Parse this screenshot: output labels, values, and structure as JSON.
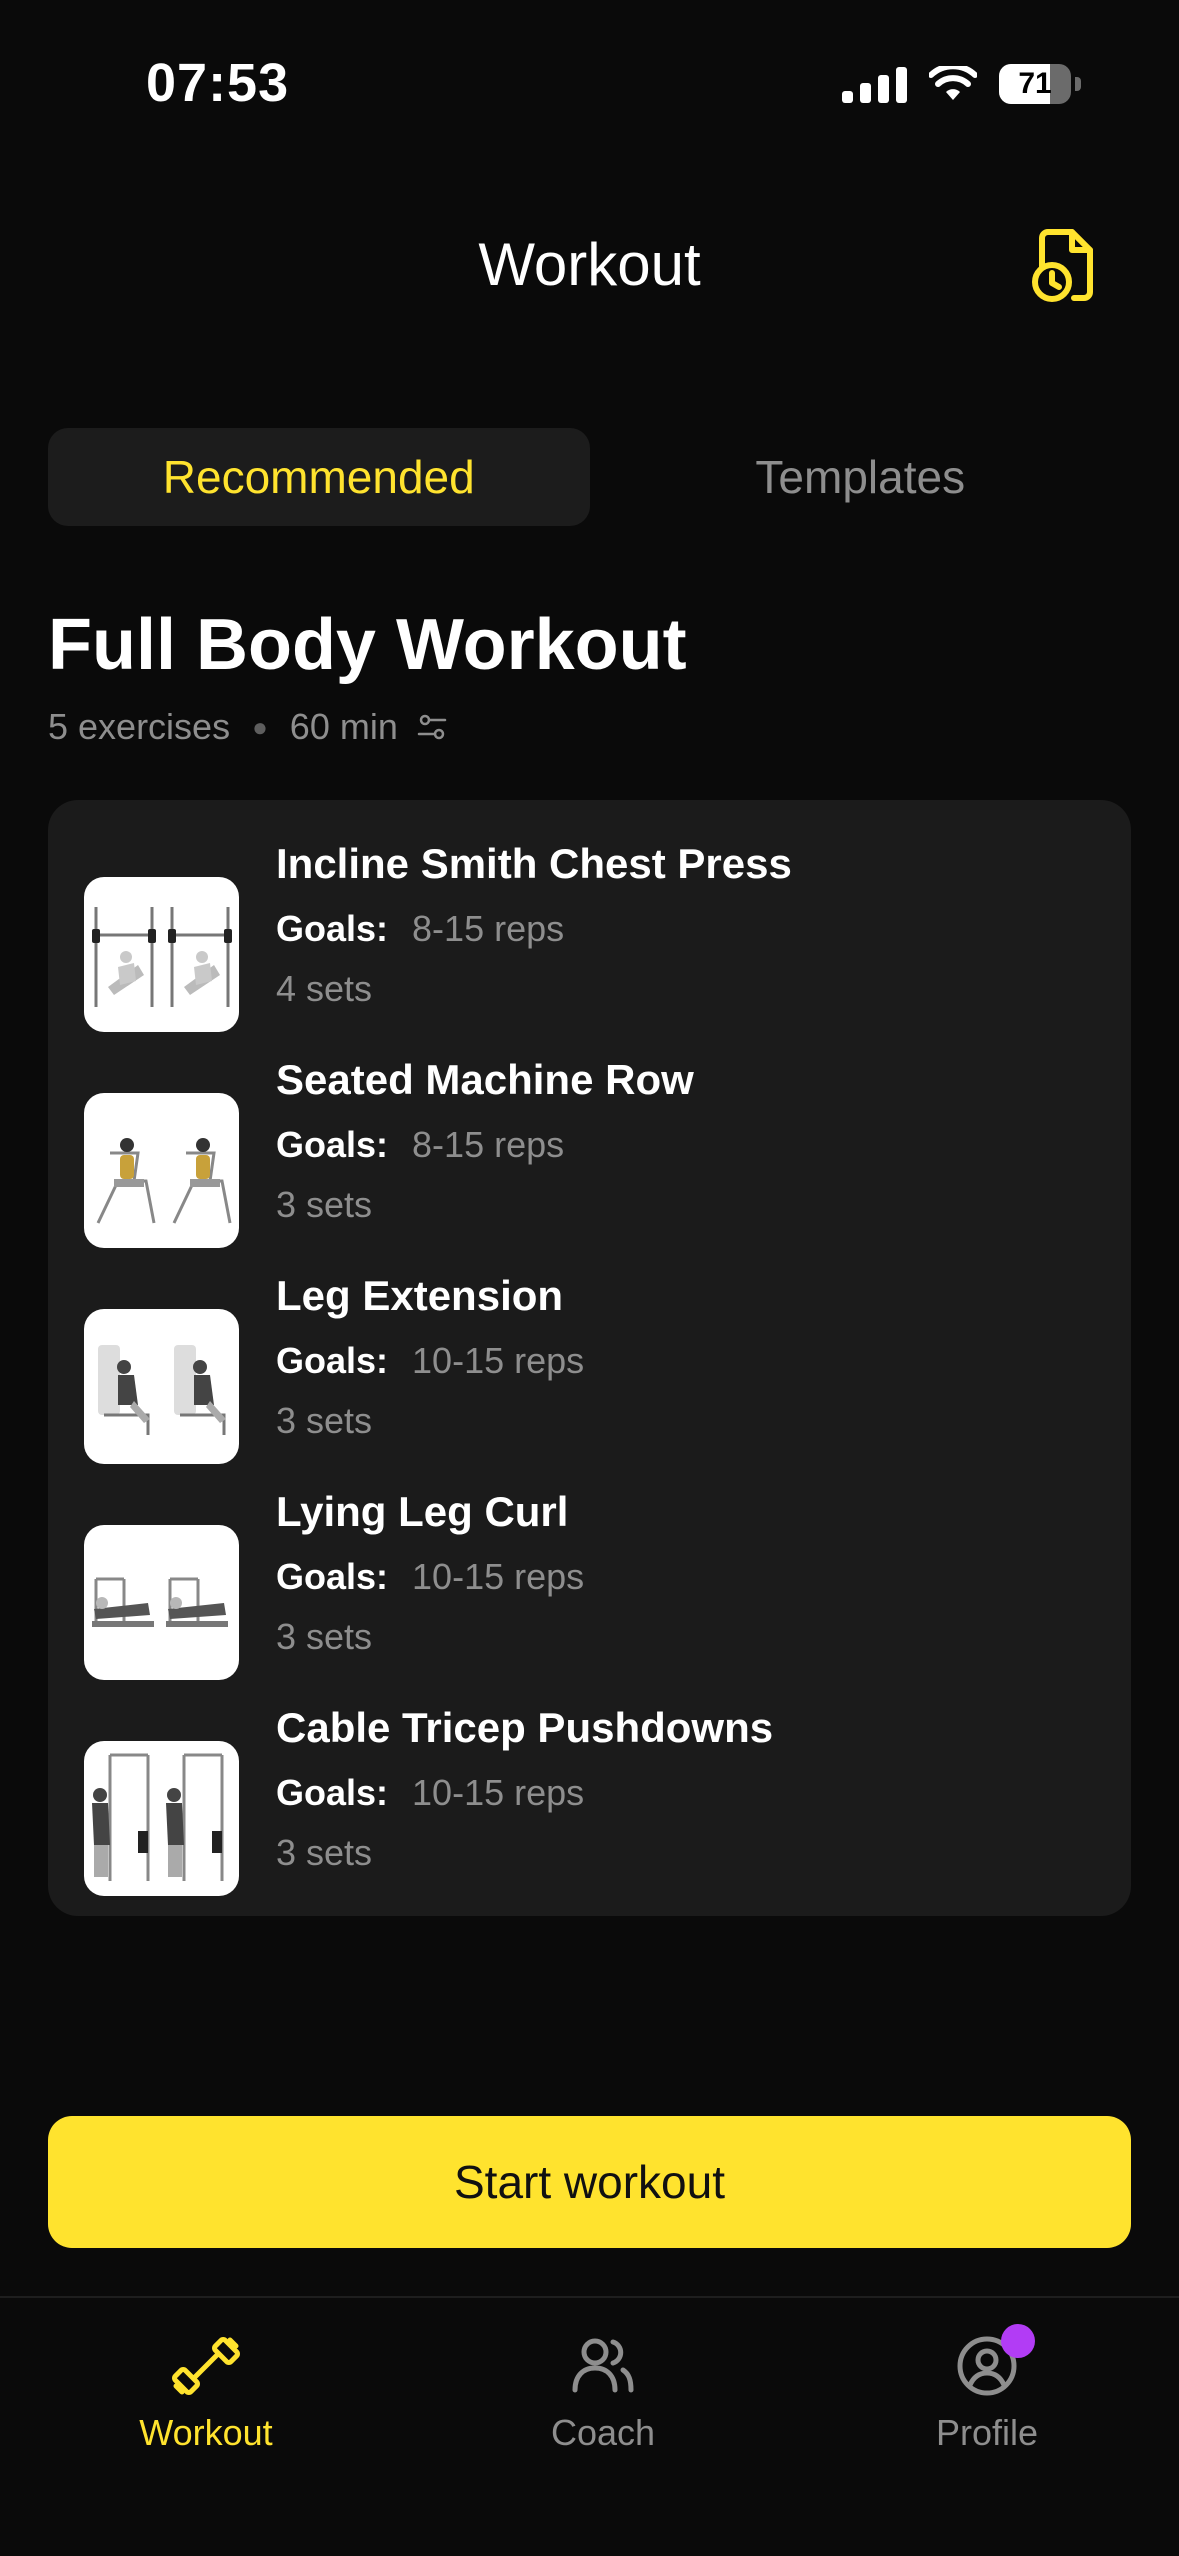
{
  "status_bar": {
    "time": "07:53",
    "battery": "71",
    "battery_level": 0.71
  },
  "header": {
    "title": "Workout",
    "history_icon": "history-icon"
  },
  "tabs": [
    {
      "label": "Recommended",
      "active": true
    },
    {
      "label": "Templates",
      "active": false
    }
  ],
  "workout": {
    "title": "Full Body Workout",
    "exercise_count": "5 exercises",
    "duration": "60 min"
  },
  "exercises": [
    {
      "name": "Incline Smith Chest Press",
      "goals_label": "Goals:",
      "reps": "8-15 reps",
      "sets": "4 sets"
    },
    {
      "name": "Seated Machine Row",
      "goals_label": "Goals:",
      "reps": "8-15 reps",
      "sets": "3 sets"
    },
    {
      "name": "Leg Extension",
      "goals_label": "Goals:",
      "reps": "10-15 reps",
      "sets": "3 sets"
    },
    {
      "name": "Lying Leg Curl",
      "goals_label": "Goals:",
      "reps": "10-15 reps",
      "sets": "3 sets"
    },
    {
      "name": "Cable Tricep Pushdowns",
      "goals_label": "Goals:",
      "reps": "10-15 reps",
      "sets": "3 sets"
    }
  ],
  "start_button": {
    "label": "Start workout"
  },
  "bottom_nav": [
    {
      "label": "Workout",
      "icon": "dumbbell-icon",
      "active": true
    },
    {
      "label": "Coach",
      "icon": "users-icon",
      "active": false
    },
    {
      "label": "Profile",
      "icon": "user-circle-icon",
      "active": false,
      "badge": true
    }
  ],
  "colors": {
    "accent": "#ffe32e",
    "background": "#0a0a0a",
    "card": "#1b1b1b",
    "muted": "#8e8e8e",
    "badge": "#b23cf5"
  }
}
